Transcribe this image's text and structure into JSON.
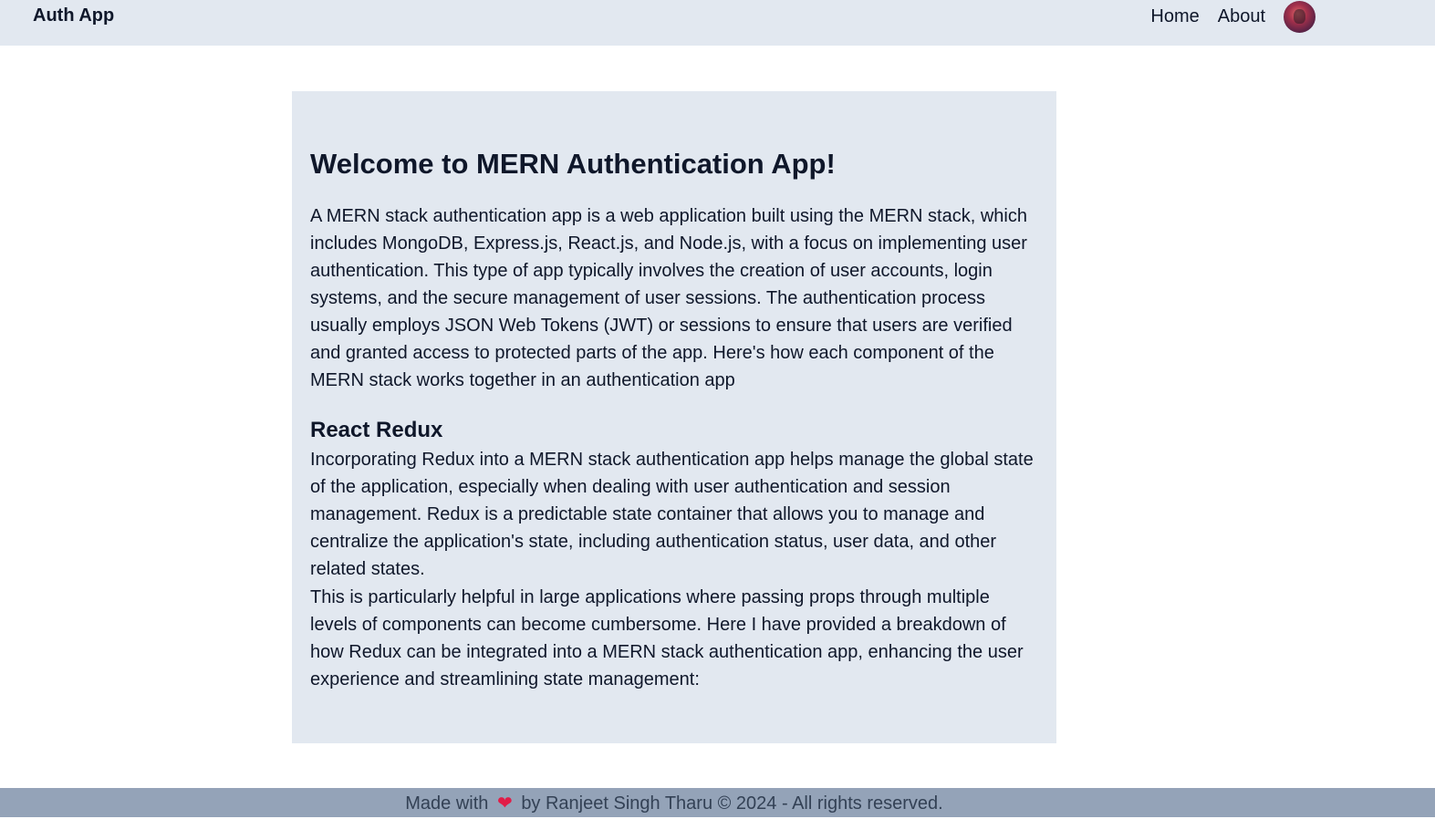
{
  "navbar": {
    "brand": "Auth App",
    "links": [
      {
        "label": "Home"
      },
      {
        "label": "About"
      }
    ],
    "avatar_alt": "profile"
  },
  "main": {
    "title": "Welcome to MERN Authentication App!",
    "intro": "A MERN stack authentication app is a web application built using the MERN stack, which includes MongoDB, Express.js, React.js, and Node.js, with a focus on implementing user authentication. This type of app typically involves the creation of user accounts, login systems, and the secure management of user sessions. The authentication process usually employs JSON Web Tokens (JWT) or sessions to ensure that users are verified and granted access to protected parts of the app. Here's how each component of the MERN stack works together in an authentication app",
    "section": {
      "heading": "React Redux",
      "paragraphs": [
        "Incorporating Redux into a MERN stack authentication app helps manage the global state of the application, especially when dealing with user authentication and session management. Redux is a predictable state container that allows you to manage and centralize the application's state, including authentication status, user data, and other related states.",
        "This is particularly helpful in large applications where passing props through multiple levels of components can become cumbersome. Here I have provided a breakdown of how Redux can be integrated into a MERN stack authentication app, enhancing the user experience and streamlining state management:"
      ]
    }
  },
  "footer": {
    "prefix": "Made with",
    "heart": "❤",
    "suffix": "by Ranjeet Singh Tharu © 2024 - All rights reserved."
  },
  "colors": {
    "navbar_bg": "#e2e8f0",
    "card_bg": "#e2e8f0",
    "footer_bg": "#94a3b8",
    "heart": "#e11d48",
    "text": "#0f172a"
  }
}
